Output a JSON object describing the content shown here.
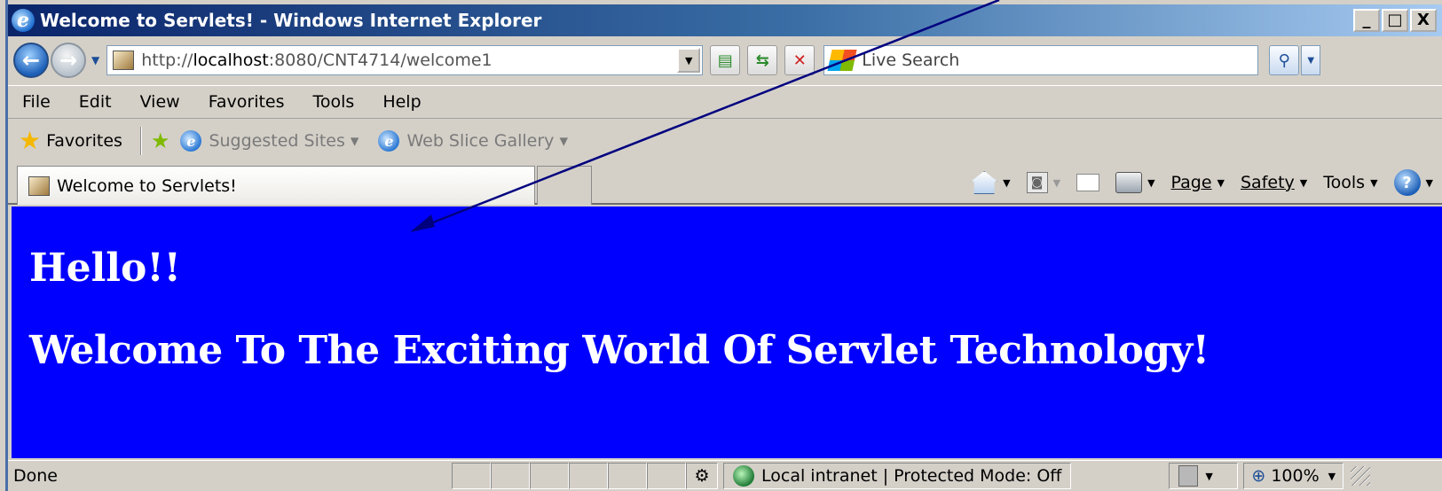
{
  "window": {
    "title": "Welcome to Servlets! - Windows Internet Explorer",
    "minimize": "_",
    "maximize": "□",
    "close": "X"
  },
  "nav": {
    "url_prefix": "http://",
    "url_host": "localhost",
    "url_rest": ":8080/CNT4714/welcome1",
    "search_placeholder": "Live Search"
  },
  "menu": {
    "items": [
      {
        "label": "File"
      },
      {
        "label": "Edit"
      },
      {
        "label": "View"
      },
      {
        "label": "Favorites"
      },
      {
        "label": "Tools"
      },
      {
        "label": "Help"
      }
    ]
  },
  "favorites_bar": {
    "favorites_label": "Favorites",
    "links": [
      {
        "label": "Suggested Sites"
      },
      {
        "label": "Web Slice Gallery"
      }
    ]
  },
  "tab": {
    "title": "Welcome to Servlets!"
  },
  "command_bar": {
    "page": "Page",
    "safety": "Safety",
    "tools": "Tools"
  },
  "content": {
    "background": "#0000ff",
    "heading1": "Hello!!",
    "heading2": "Welcome To The Exciting World Of Servlet Technology!"
  },
  "status": {
    "text": "Done",
    "zone": "Local intranet | Protected Mode: Off",
    "zoom": "100%"
  },
  "icons": {
    "back": "back-arrow-icon",
    "forward": "forward-arrow-icon",
    "refresh": "refresh-icon",
    "stop": "stop-icon",
    "search": "search-icon",
    "home": "home-icon",
    "feeds": "rss-feed-icon",
    "mail": "mail-icon",
    "print": "printer-icon",
    "help": "help-icon"
  }
}
